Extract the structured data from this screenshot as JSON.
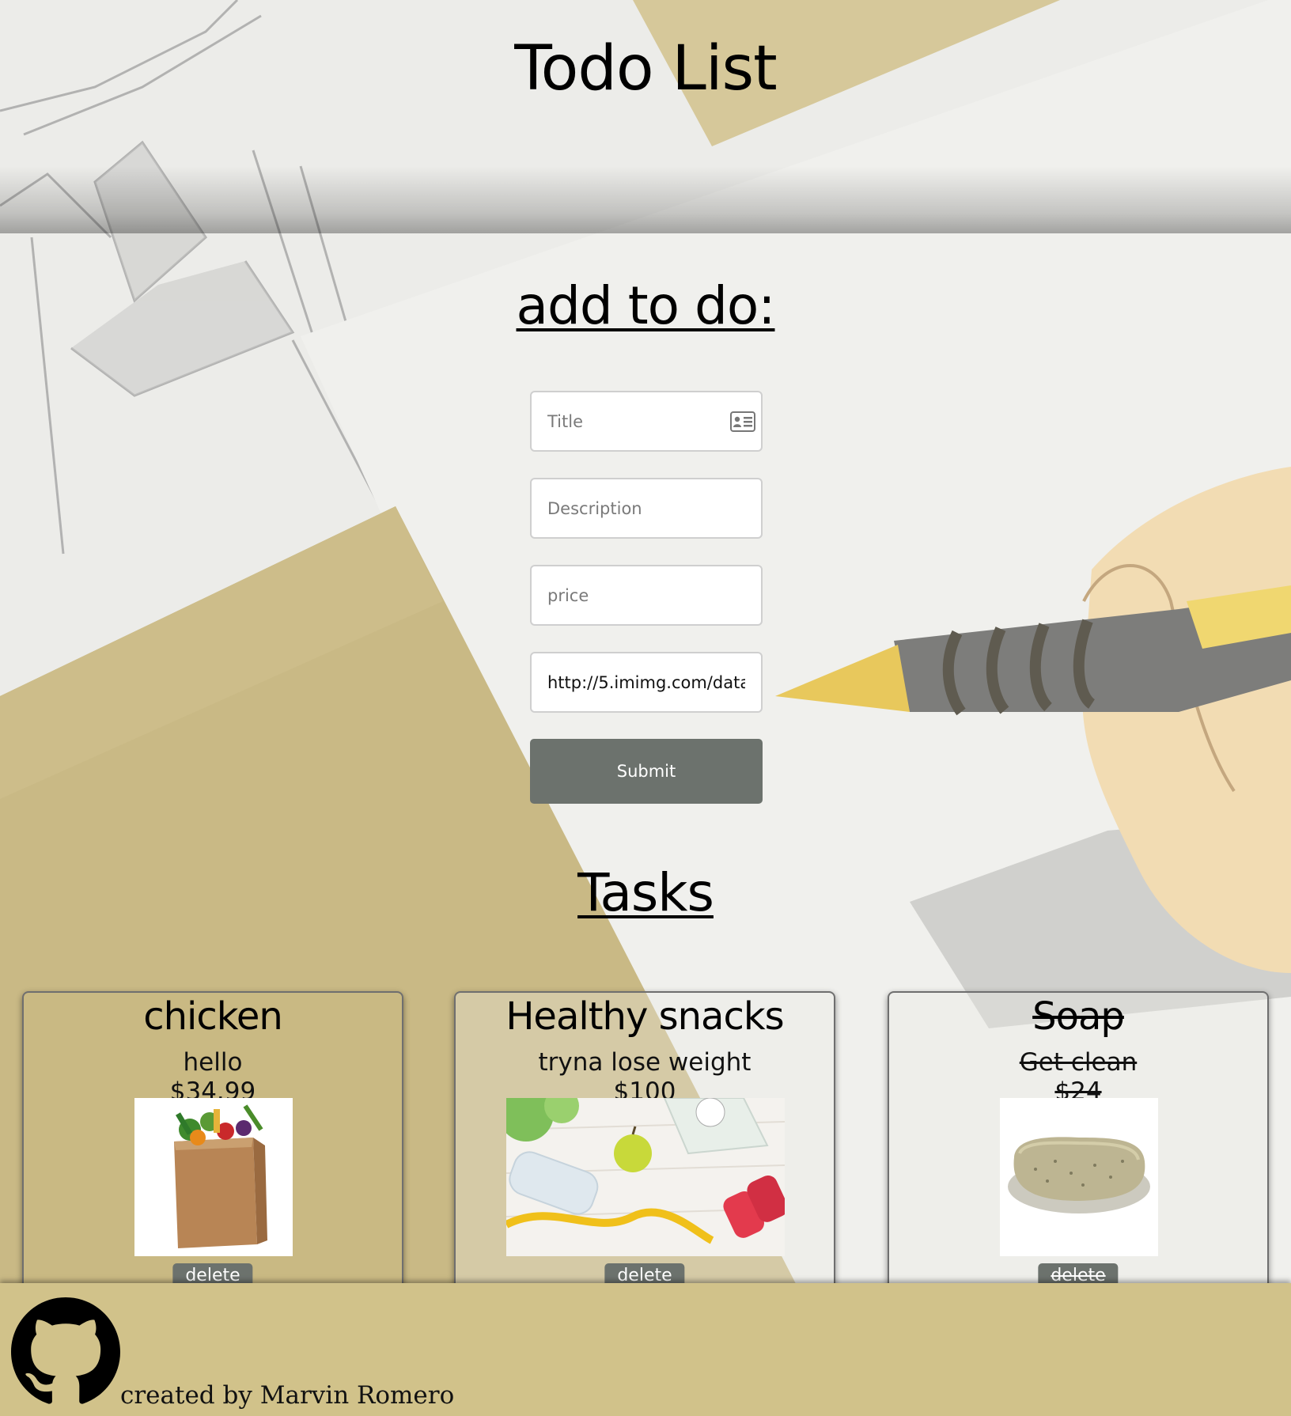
{
  "header": {
    "title": "Todo List"
  },
  "form": {
    "heading": "add to do:",
    "title_placeholder": "Title",
    "description_placeholder": "Description",
    "price_placeholder": "price",
    "image_value": "http://5.imimg.com/data",
    "submit_label": "Submit"
  },
  "tasks": {
    "heading": "Tasks",
    "items": [
      {
        "title": "chicken",
        "description": "hello",
        "price": "$34.99",
        "image_icon": "grocery-bag-image",
        "completed": false,
        "delete_label": "delete"
      },
      {
        "title": "Healthy snacks",
        "description": "tryna lose weight",
        "price": "$100",
        "image_icon": "fitness-items-image",
        "completed": false,
        "delete_label": "delete"
      },
      {
        "title": "Soap",
        "description": "Get clean",
        "price": "$24",
        "image_icon": "soap-bar-image",
        "completed": true,
        "delete_label": "delete"
      }
    ]
  },
  "footer": {
    "credit": "created by Marvin Romero",
    "icon": "github-icon"
  },
  "colors": {
    "submit_button": "#6c726d",
    "footer_background": "#d1c28a",
    "paper_background": "#ecece9",
    "cardboard": "#c9b985"
  }
}
